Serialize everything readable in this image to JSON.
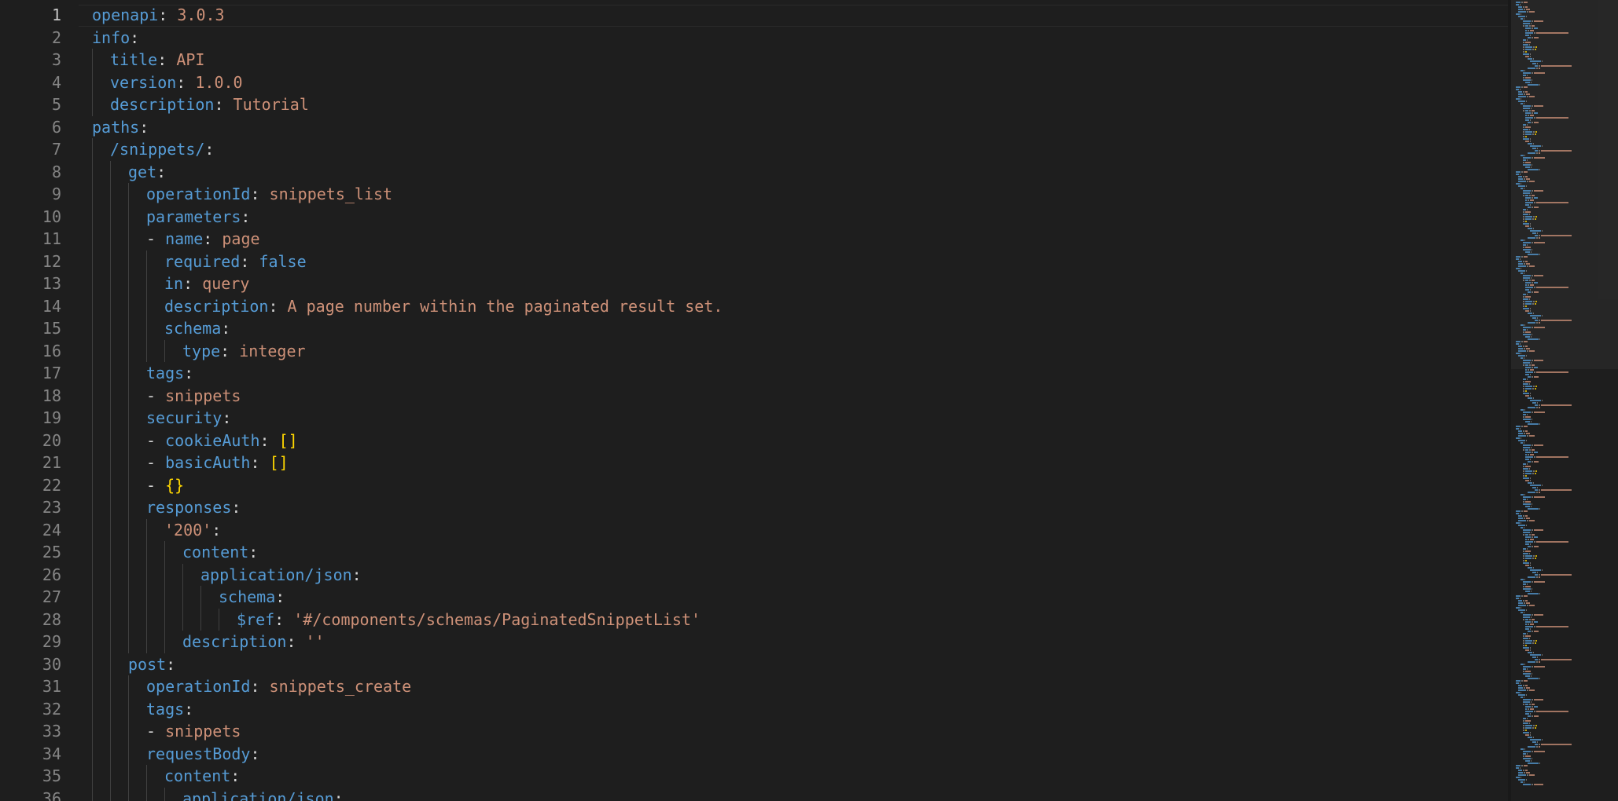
{
  "editor": {
    "language": "yaml",
    "active_line": 1,
    "lines": [
      {
        "n": "1",
        "indent": 0,
        "segs": [
          [
            "openapi",
            "k"
          ],
          [
            ": ",
            "p"
          ],
          [
            "3.0.3",
            "s"
          ]
        ]
      },
      {
        "n": "2",
        "indent": 0,
        "segs": [
          [
            "info",
            "k"
          ],
          [
            ":",
            "p"
          ]
        ]
      },
      {
        "n": "3",
        "indent": 1,
        "segs": [
          [
            "title",
            "k"
          ],
          [
            ": ",
            "p"
          ],
          [
            "API",
            "s"
          ]
        ]
      },
      {
        "n": "4",
        "indent": 1,
        "segs": [
          [
            "version",
            "k"
          ],
          [
            ": ",
            "p"
          ],
          [
            "1.0.0",
            "s"
          ]
        ]
      },
      {
        "n": "5",
        "indent": 1,
        "segs": [
          [
            "description",
            "k"
          ],
          [
            ": ",
            "p"
          ],
          [
            "Tutorial",
            "s"
          ]
        ]
      },
      {
        "n": "6",
        "indent": 0,
        "segs": [
          [
            "paths",
            "k"
          ],
          [
            ":",
            "p"
          ]
        ]
      },
      {
        "n": "7",
        "indent": 1,
        "segs": [
          [
            "/snippets/",
            "k"
          ],
          [
            ":",
            "p"
          ]
        ]
      },
      {
        "n": "8",
        "indent": 2,
        "segs": [
          [
            "get",
            "k"
          ],
          [
            ":",
            "p"
          ]
        ]
      },
      {
        "n": "9",
        "indent": 3,
        "segs": [
          [
            "operationId",
            "k"
          ],
          [
            ": ",
            "p"
          ],
          [
            "snippets_list",
            "s"
          ]
        ]
      },
      {
        "n": "10",
        "indent": 3,
        "segs": [
          [
            "parameters",
            "k"
          ],
          [
            ":",
            "p"
          ]
        ]
      },
      {
        "n": "11",
        "indent": 3,
        "segs": [
          [
            "- ",
            "p"
          ],
          [
            "name",
            "k"
          ],
          [
            ": ",
            "p"
          ],
          [
            "page",
            "s"
          ]
        ]
      },
      {
        "n": "12",
        "indent": 4,
        "segs": [
          [
            "required",
            "k"
          ],
          [
            ": ",
            "p"
          ],
          [
            "false",
            "k"
          ]
        ]
      },
      {
        "n": "13",
        "indent": 4,
        "segs": [
          [
            "in",
            "k"
          ],
          [
            ": ",
            "p"
          ],
          [
            "query",
            "s"
          ]
        ]
      },
      {
        "n": "14",
        "indent": 4,
        "segs": [
          [
            "description",
            "k"
          ],
          [
            ": ",
            "p"
          ],
          [
            "A page number within the paginated result set.",
            "s"
          ]
        ]
      },
      {
        "n": "15",
        "indent": 4,
        "segs": [
          [
            "schema",
            "k"
          ],
          [
            ":",
            "p"
          ]
        ]
      },
      {
        "n": "16",
        "indent": 5,
        "segs": [
          [
            "type",
            "k"
          ],
          [
            ": ",
            "p"
          ],
          [
            "integer",
            "s"
          ]
        ]
      },
      {
        "n": "17",
        "indent": 3,
        "segs": [
          [
            "tags",
            "k"
          ],
          [
            ":",
            "p"
          ]
        ]
      },
      {
        "n": "18",
        "indent": 3,
        "segs": [
          [
            "- ",
            "p"
          ],
          [
            "snippets",
            "s"
          ]
        ]
      },
      {
        "n": "19",
        "indent": 3,
        "segs": [
          [
            "security",
            "k"
          ],
          [
            ":",
            "p"
          ]
        ]
      },
      {
        "n": "20",
        "indent": 3,
        "segs": [
          [
            "- ",
            "p"
          ],
          [
            "cookieAuth",
            "k"
          ],
          [
            ": ",
            "p"
          ],
          [
            "[]",
            "b"
          ]
        ]
      },
      {
        "n": "21",
        "indent": 3,
        "segs": [
          [
            "- ",
            "p"
          ],
          [
            "basicAuth",
            "k"
          ],
          [
            ": ",
            "p"
          ],
          [
            "[]",
            "b"
          ]
        ]
      },
      {
        "n": "22",
        "indent": 3,
        "segs": [
          [
            "- ",
            "p"
          ],
          [
            "{}",
            "b"
          ]
        ]
      },
      {
        "n": "23",
        "indent": 3,
        "segs": [
          [
            "responses",
            "k"
          ],
          [
            ":",
            "p"
          ]
        ]
      },
      {
        "n": "24",
        "indent": 4,
        "segs": [
          [
            "'200'",
            "s"
          ],
          [
            ":",
            "p"
          ]
        ]
      },
      {
        "n": "25",
        "indent": 5,
        "segs": [
          [
            "content",
            "k"
          ],
          [
            ":",
            "p"
          ]
        ]
      },
      {
        "n": "26",
        "indent": 6,
        "segs": [
          [
            "application/json",
            "k"
          ],
          [
            ":",
            "p"
          ]
        ]
      },
      {
        "n": "27",
        "indent": 7,
        "segs": [
          [
            "schema",
            "k"
          ],
          [
            ":",
            "p"
          ]
        ]
      },
      {
        "n": "28",
        "indent": 8,
        "segs": [
          [
            "$ref",
            "k"
          ],
          [
            ": ",
            "p"
          ],
          [
            "'#/components/schemas/PaginatedSnippetList'",
            "s"
          ]
        ]
      },
      {
        "n": "29",
        "indent": 5,
        "segs": [
          [
            "description",
            "k"
          ],
          [
            ": ",
            "p"
          ],
          [
            "''",
            "s"
          ]
        ]
      },
      {
        "n": "30",
        "indent": 2,
        "segs": [
          [
            "post",
            "k"
          ],
          [
            ":",
            "p"
          ]
        ]
      },
      {
        "n": "31",
        "indent": 3,
        "segs": [
          [
            "operationId",
            "k"
          ],
          [
            ": ",
            "p"
          ],
          [
            "snippets_create",
            "s"
          ]
        ]
      },
      {
        "n": "32",
        "indent": 3,
        "segs": [
          [
            "tags",
            "k"
          ],
          [
            ":",
            "p"
          ]
        ]
      },
      {
        "n": "33",
        "indent": 3,
        "segs": [
          [
            "- ",
            "p"
          ],
          [
            "snippets",
            "s"
          ]
        ]
      },
      {
        "n": "34",
        "indent": 3,
        "segs": [
          [
            "requestBody",
            "k"
          ],
          [
            ":",
            "p"
          ]
        ]
      },
      {
        "n": "35",
        "indent": 4,
        "segs": [
          [
            "content",
            "k"
          ],
          [
            ":",
            "p"
          ]
        ]
      },
      {
        "n": "36",
        "indent": 5,
        "segs": [
          [
            "application/json",
            "k"
          ],
          [
            ":",
            "p"
          ]
        ]
      }
    ]
  },
  "colors": {
    "background": "#1e1e1e",
    "key": "#569cd6",
    "string": "#ce9178",
    "punctuation": "#d4d4d4",
    "bracket": "#ffd700",
    "line_number": "#858585",
    "active_line_number": "#c6c6c6"
  }
}
